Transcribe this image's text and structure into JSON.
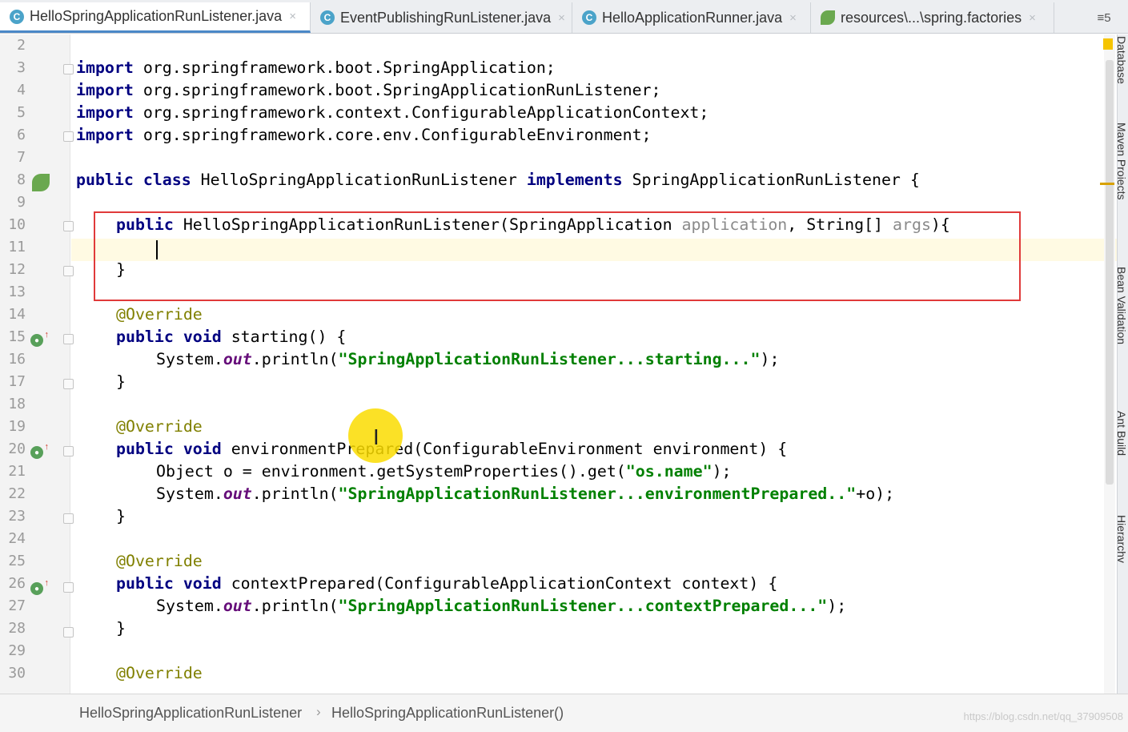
{
  "tabs": [
    {
      "label": "HelloSpringApplicationRunListener.java",
      "icon": "class-icon",
      "active": true
    },
    {
      "label": "EventPublishingRunListener.java",
      "icon": "class-icon",
      "active": false
    },
    {
      "label": "HelloApplicationRunner.java",
      "icon": "class-icon",
      "active": false
    },
    {
      "label": "resources\\...\\spring.factories",
      "icon": "spring-factories-icon",
      "active": false
    }
  ],
  "tab_overflow": "≡5",
  "tab_close_glyph": "×",
  "class_glyph": "C",
  "line_numbers": [
    "2",
    "3",
    "4",
    "5",
    "6",
    "7",
    "8",
    "9",
    "10",
    "11",
    "12",
    "13",
    "14",
    "15",
    "16",
    "17",
    "18",
    "19",
    "20",
    "21",
    "22",
    "23",
    "24",
    "25",
    "26",
    "27",
    "28",
    "29",
    "30"
  ],
  "code": {
    "l3": {
      "k": "import",
      "t": " org.springframework.boot.SpringApplication;"
    },
    "l4": {
      "k": "import",
      "t": " org.springframework.boot.SpringApplicationRunListener;"
    },
    "l5": {
      "k": "import",
      "t": " org.springframework.context.ConfigurableApplicationContext;"
    },
    "l6": {
      "k": "import",
      "t": " org.springframework.core.env.ConfigurableEnvironment;"
    },
    "l8": {
      "k1": "public class",
      "t1": " HelloSpringApplicationRunListener ",
      "k2": "implements",
      "t2": " SpringApplicationRunListener {"
    },
    "l10": {
      "k": "public",
      "t1": " HelloSpringApplicationRunListener(SpringApplication ",
      "p1": "application",
      "t2": ", String[] ",
      "p2": "args",
      "t3": "){"
    },
    "l12": {
      "t": "}"
    },
    "l14": {
      "a": "@Override"
    },
    "l15": {
      "k": "public void",
      "t": " starting() {"
    },
    "l16": {
      "t1": "System.",
      "f": "out",
      "t2": ".println(",
      "s": "\"SpringApplicationRunListener...starting...\"",
      "t3": ");"
    },
    "l17": {
      "t": "}"
    },
    "l19": {
      "a": "@Override"
    },
    "l20": {
      "k": "public void",
      "t": " environmentPrepared(ConfigurableEnvironment environment) {"
    },
    "l21": {
      "t1": "Object o = environment.getSystemProperties().get(",
      "s": "\"os.name\"",
      "t2": ");"
    },
    "l22": {
      "t1": "System.",
      "f": "out",
      "t2": ".println(",
      "s": "\"SpringApplicationRunListener...environmentPrepared..\"",
      "t3": "+o);"
    },
    "l23": {
      "t": "}"
    },
    "l25": {
      "a": "@Override"
    },
    "l26": {
      "k": "public void",
      "t": " contextPrepared(ConfigurableApplicationContext context) {"
    },
    "l27": {
      "t1": "System.",
      "f": "out",
      "t2": ".println(",
      "s": "\"SpringApplicationRunListener...contextPrepared...\"",
      "t3": ");"
    },
    "l28": {
      "t": "}"
    },
    "l30": {
      "a": "@Override"
    }
  },
  "side_tools": [
    "Database",
    "Maven Projects",
    "Bean Validation",
    "Ant Build",
    "Hierarchy"
  ],
  "breadcrumb": [
    "HelloSpringApplicationRunListener",
    "HelloSpringApplicationRunListener()"
  ],
  "breadcrumb_sep": "›",
  "watermark": "https://blog.csdn.net/qq_37909508",
  "colors": {
    "keyword": "#000080",
    "string": "#008000",
    "annotation": "#808000",
    "highlight_box": "#e03a3a",
    "caret_line": "#fffae3"
  }
}
